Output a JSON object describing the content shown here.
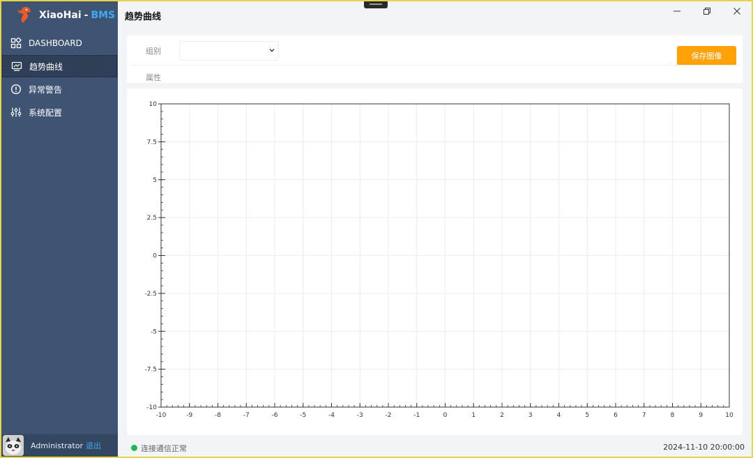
{
  "app": {
    "brand_name": "XiaoHai",
    "brand_separator": "-",
    "brand_accent": "BMS",
    "accent_color": "#3fa9f5",
    "sidebar_color": "#3f5473",
    "primary_button_color": "#ffa208"
  },
  "sidebar": {
    "items": [
      {
        "label": "DASHBOARD",
        "icon": "dashboard-icon",
        "active": false
      },
      {
        "label": "趋势曲线",
        "icon": "trend-monitor-icon",
        "active": true
      },
      {
        "label": "异常警告",
        "icon": "alert-circle-icon",
        "active": false
      },
      {
        "label": "系统配置",
        "icon": "sliders-icon",
        "active": false
      }
    ],
    "user": {
      "name": "Administrator",
      "logout_label": "退出",
      "avatar_icon": "user-avatar"
    }
  },
  "header": {
    "title": "趋势曲线",
    "window_controls": {
      "minimize": "minimize-icon",
      "restore": "restore-icon",
      "close": "close-icon"
    }
  },
  "filters": {
    "group_label": "组别",
    "group_value": "",
    "attribute_label": "属性",
    "save_label": "保存图像"
  },
  "chart_data": {
    "type": "line",
    "series": [],
    "xlim": [
      -10,
      10
    ],
    "ylim": [
      -10,
      10
    ],
    "x_ticks": [
      "-10",
      "-9",
      "-8",
      "-7",
      "-6",
      "-5",
      "-4",
      "-3",
      "-2",
      "-1",
      "0",
      "1",
      "2",
      "3",
      "4",
      "5",
      "6",
      "7",
      "8",
      "9",
      "10"
    ],
    "y_ticks": [
      "10",
      "7.5",
      "5",
      "2.5",
      "0",
      "-2.5",
      "-5",
      "-7.5",
      "-10"
    ],
    "grid": true
  },
  "status": {
    "connection_text": "连接通信正常",
    "connection_color": "#1db954",
    "timestamp": "2024-11-10 20:00:00"
  }
}
